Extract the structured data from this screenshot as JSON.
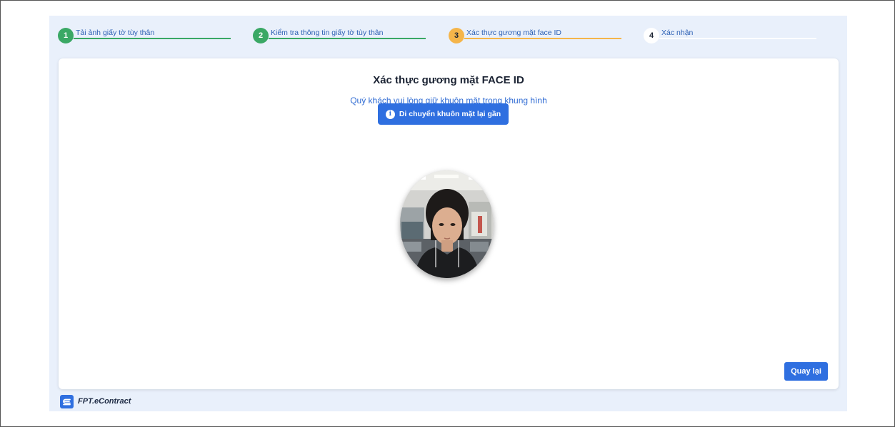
{
  "steps": [
    {
      "number": "1",
      "label": "Tải ảnh giấy tờ tùy thân",
      "state": "done"
    },
    {
      "number": "2",
      "label": "Kiểm tra thông tin giấy tờ tùy thân",
      "state": "done"
    },
    {
      "number": "3",
      "label": "Xác thực gương mặt face ID",
      "state": "active"
    },
    {
      "number": "4",
      "label": "Xác nhận",
      "state": "pending"
    }
  ],
  "colors": {
    "done": "#3aa865",
    "active": "#f5b54a",
    "pending": "#ffffff",
    "primary": "#2f6fe0"
  },
  "card": {
    "title": "Xác thực gương mặt FACE ID",
    "subtitle": "Quý khách vui lòng giữ khuôn mặt trong khung hình",
    "hint": "Di chuyển khuôn mặt lại gần",
    "hint_icon": "info-icon"
  },
  "actions": {
    "back_label": "Quay lại"
  },
  "footer": {
    "brand": "FPT.eContract"
  }
}
